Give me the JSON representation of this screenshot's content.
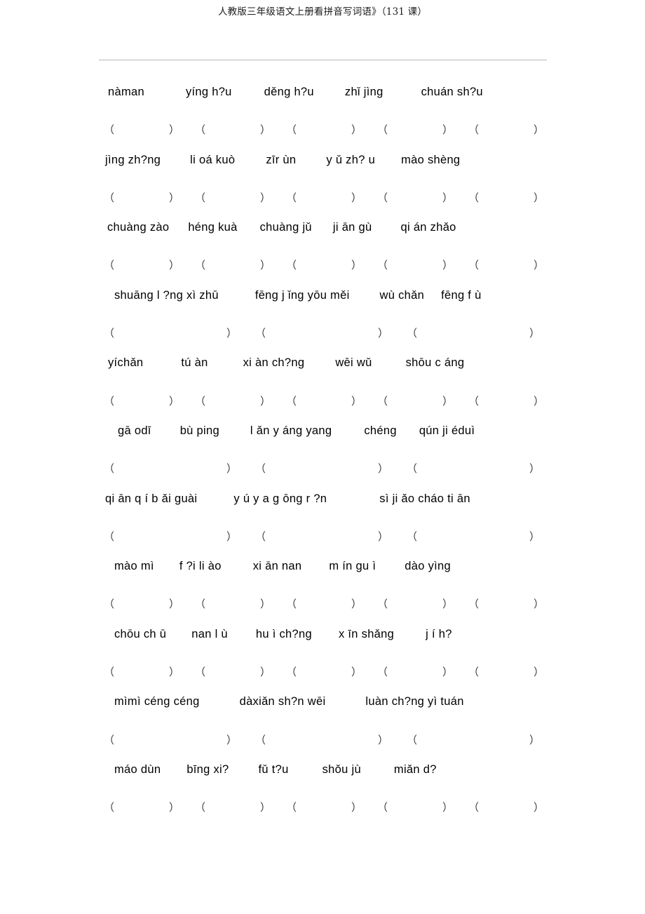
{
  "document": {
    "header_title": "人教版三年级语文上册看拼音写词语》（131 课）",
    "paren_open": "（",
    "paren_close": "）"
  },
  "worksheet": {
    "rows": [
      {
        "id": 1,
        "items": [
          "nàman",
          "yíng h?u",
          "děng h?u",
          "zhǐ jìng",
          "chuán sh?u"
        ],
        "blanks": 5
      },
      {
        "id": 2,
        "items": [
          "jìng zh?ng",
          "li oá kuò",
          "zīr ùn",
          "y ǔ zh? u",
          "mào shèng"
        ],
        "blanks": 5
      },
      {
        "id": 3,
        "items": [
          "chuàng zào",
          "héng kuà",
          "chuàng jǔ",
          "ji ān gù",
          "qi án zhǎo"
        ],
        "blanks": 5
      },
      {
        "id": 4,
        "items": [
          "shuāng l ?ng xì zhū",
          "fēng j ǐng yōu měi",
          "wù chǎn",
          "fēng f ù"
        ],
        "blanks": 3
      },
      {
        "id": 5,
        "items": [
          "yíchǎn",
          "tú àn",
          "xi àn ch?ng",
          "wēi wǔ",
          "shōu c áng"
        ],
        "blanks": 5
      },
      {
        "id": 6,
        "items": [
          "gā odī",
          "bù ping",
          "l ǎn y áng yang",
          "chéng",
          "qún ji éduì"
        ],
        "blanks": 3
      },
      {
        "id": 7,
        "items": [
          "qi ān q í b ǎi guài",
          "y ú y a g ōng r ?n",
          "sì ji ǎo cháo ti ān"
        ],
        "blanks": 3
      },
      {
        "id": 8,
        "items": [
          "mào mì",
          "f ?i li ào",
          "xi ān nan",
          "m ín gu ì",
          "dào yìng"
        ],
        "blanks": 5
      },
      {
        "id": 9,
        "items": [
          "chōu ch ū",
          "nan l ù",
          "hu ì ch?ng",
          "x īn shǎng",
          "j í h?"
        ],
        "blanks": 5
      },
      {
        "id": 10,
        "items": [
          "mìmì céng céng",
          "dàxiǎn sh?n wēi",
          "luàn ch?ng yì tuán"
        ],
        "blanks": 3
      },
      {
        "id": 11,
        "items": [
          "máo dùn",
          "bīng xi?",
          "fǔ t?u",
          "shǒu jù",
          "miǎn d?"
        ],
        "blanks": 5
      }
    ]
  }
}
